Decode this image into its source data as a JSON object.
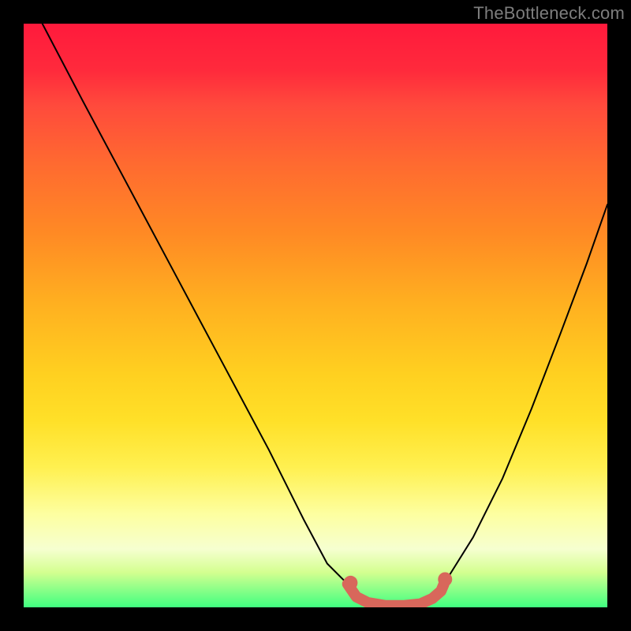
{
  "watermark": "TheBottleneck.com",
  "chart_data": {
    "type": "line",
    "title": "",
    "xlabel": "",
    "ylabel": "",
    "xlim": [
      0,
      1
    ],
    "ylim": [
      0,
      1
    ],
    "series": [
      {
        "name": "left-branch",
        "x": [
          0.032,
          0.1,
          0.18,
          0.26,
          0.34,
          0.42,
          0.48,
          0.52,
          0.555
        ],
        "y": [
          1.0,
          0.87,
          0.72,
          0.57,
          0.42,
          0.27,
          0.15,
          0.075,
          0.04
        ],
        "stroke": "#000000",
        "width": 2
      },
      {
        "name": "right-branch",
        "x": [
          0.72,
          0.77,
          0.82,
          0.87,
          0.92,
          0.965,
          1.0
        ],
        "y": [
          0.04,
          0.12,
          0.22,
          0.34,
          0.47,
          0.59,
          0.69
        ],
        "stroke": "#000000",
        "width": 2
      },
      {
        "name": "bottom-highlight",
        "x": [
          0.555,
          0.57,
          0.59,
          0.62,
          0.65,
          0.68,
          0.7,
          0.715,
          0.72
        ],
        "y": [
          0.04,
          0.018,
          0.008,
          0.003,
          0.003,
          0.006,
          0.015,
          0.028,
          0.04
        ],
        "stroke": "#d8675b",
        "width": 14
      }
    ],
    "markers": [
      {
        "name": "highlight-left-cap",
        "x": 0.56,
        "y": 0.042,
        "r": 9,
        "fill": "#d8675b"
      },
      {
        "name": "highlight-right-cap",
        "x": 0.722,
        "y": 0.048,
        "r": 9,
        "fill": "#d8675b"
      }
    ]
  }
}
